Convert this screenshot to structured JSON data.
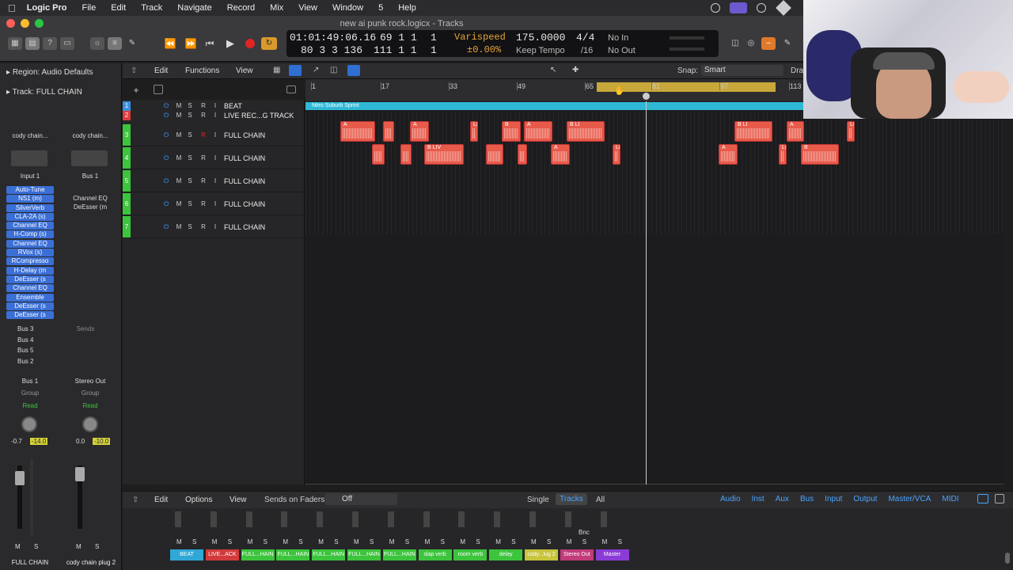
{
  "menubar": {
    "items": [
      "Logic Pro",
      "File",
      "Edit",
      "Track",
      "Navigate",
      "Record",
      "Mix",
      "View",
      "Window",
      "5",
      "Help"
    ]
  },
  "window": {
    "title": "new ai punk rock.logicx - Tracks"
  },
  "transport": {
    "time": "01:01:49:06.16",
    "bars_top": "69  1  1",
    "bars_top_tick": "1",
    "time_sub": "80  3  3  136",
    "bars_bottom": "111  1  1",
    "bars_bottom_tick": "1",
    "varispeed": "Varispeed",
    "varispeed_value": "±0.00%",
    "tempo": "175.0000",
    "tempo_mode": "Keep Tempo",
    "signature": "4/4",
    "division": "/16",
    "in": "No In",
    "out": "No Out"
  },
  "inspector": {
    "region": "Region: Audio Defaults",
    "track": "Track:  FULL CHAIN",
    "strip1": {
      "name": "cody chain...",
      "input": "Input 1",
      "plugins": [
        "Auto-Tune",
        "NS1 (m)",
        "SilverVerb",
        "CLA-2A (s)",
        "Channel EQ",
        "H-Comp (s)",
        "Channel EQ",
        "RVox (s)",
        "RCompresso",
        "H-Delay (m",
        "DeEsser (s",
        "Channel EQ",
        "Ensemble",
        "DeEsser (s",
        "DeEsser (s"
      ],
      "sends": [
        "Bus 3",
        "Bus 4",
        "Bus 5",
        "Bus 2"
      ],
      "output": "Bus 1",
      "group": "Group",
      "automation": "Read",
      "pan_l": "-0.7",
      "pan_r": "-14.0",
      "label": "FULL CHAIN"
    },
    "strip2": {
      "name": "cody chain...",
      "input": "Bus 1",
      "plugins": [
        "Channel EQ",
        "DeEsser (m"
      ],
      "sends_label": "Sends",
      "output": "Stereo Out",
      "group": "Group",
      "automation": "Read",
      "pan_l": "0.0",
      "pan_r": "-10.0",
      "label": "cody chain plug 2"
    }
  },
  "tracks_bar": {
    "edit": "Edit",
    "functions": "Functions",
    "view": "View",
    "snap_label": "Snap:",
    "snap_value": "Smart",
    "drag": "Dra"
  },
  "ruler": {
    "marks": [
      "1",
      "17",
      "33",
      "49",
      "65",
      "81",
      "97",
      "113"
    ]
  },
  "tracks": [
    {
      "num": "1",
      "name": "BEAT",
      "color": "#3b8fe0"
    },
    {
      "num": "2",
      "name": "LIVE REC...G TRACK",
      "color": "#e03b3b"
    },
    {
      "num": "3",
      "name": "FULL CHAIN",
      "color": "#3cc43c"
    },
    {
      "num": "4",
      "name": "FULL CHAIN",
      "color": "#3cc43c"
    },
    {
      "num": "5",
      "name": "FULL CHAIN",
      "color": "#3cc43c"
    },
    {
      "num": "6",
      "name": "FULL CHAIN",
      "color": "#3cc43c"
    },
    {
      "num": "7",
      "name": "FULL CHAIN",
      "color": "#3cc43c"
    }
  ],
  "beat_region": "Nitro Suburb Sprint",
  "regions_row1": [
    "A",
    "",
    "A",
    "LI",
    "B",
    "A",
    "B LI",
    "",
    "B LI",
    "A",
    "LI"
  ],
  "regions_row2": [
    "",
    "",
    "B LIV",
    "",
    "",
    "A",
    "LI",
    "A",
    "LI",
    "B"
  ],
  "mixer": {
    "edit": "Edit",
    "options": "Options",
    "view": "View",
    "sends_on_faders": "Sends on Faders:",
    "sends_value": "Off",
    "tabs": [
      "Single",
      "Tracks",
      "All"
    ],
    "active_tab": "Tracks",
    "filters": [
      "Audio",
      "Inst",
      "Aux",
      "Bus",
      "Input",
      "Output",
      "Master/VCA",
      "MIDI"
    ],
    "bnc": "Bnc",
    "channels": [
      {
        "name": "BEAT",
        "color": "#2fa8d6"
      },
      {
        "name": "LIVE...ACK",
        "color": "#d23b3b"
      },
      {
        "name": "FULL...HAIN",
        "color": "#3cc43c"
      },
      {
        "name": "FULL...HAIN",
        "color": "#3cc43c"
      },
      {
        "name": "FULL...HAIN",
        "color": "#3cc43c"
      },
      {
        "name": "FULL...HAIN",
        "color": "#3cc43c"
      },
      {
        "name": "FULL...HAIN",
        "color": "#3cc43c"
      },
      {
        "name": "slap verb",
        "color": "#3cc43c"
      },
      {
        "name": "room verb",
        "color": "#3cc43c"
      },
      {
        "name": "delay",
        "color": "#3cc43c"
      },
      {
        "name": "cody...lug 2",
        "color": "#c8c43c"
      },
      {
        "name": "Stereo Out",
        "color": "#c23b7a"
      },
      {
        "name": "Master",
        "color": "#8a3bd6"
      }
    ]
  }
}
